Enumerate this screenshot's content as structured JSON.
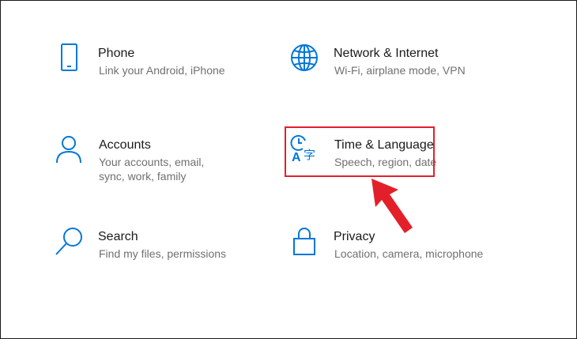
{
  "tiles": [
    {
      "id": "phone",
      "icon": "phone-icon",
      "title": "Phone",
      "desc": "Link your Android, iPhone"
    },
    {
      "id": "network",
      "icon": "globe-icon",
      "title": "Network & Internet",
      "desc": "Wi-Fi, airplane mode, VPN"
    },
    {
      "id": "accounts",
      "icon": "person-icon",
      "title": "Accounts",
      "desc": "Your accounts, email, sync, work, family"
    },
    {
      "id": "time",
      "icon": "time-language-icon",
      "title": "Time & Language",
      "desc": "Speech, region, date"
    },
    {
      "id": "search",
      "icon": "search-icon",
      "title": "Search",
      "desc": "Find my files, permissions"
    },
    {
      "id": "privacy",
      "icon": "lock-icon",
      "title": "Privacy",
      "desc": "Location, camera, microphone"
    }
  ],
  "colors": {
    "accent": "#0078d7",
    "highlight": "#e2202c",
    "arrow": "#e3202a"
  }
}
